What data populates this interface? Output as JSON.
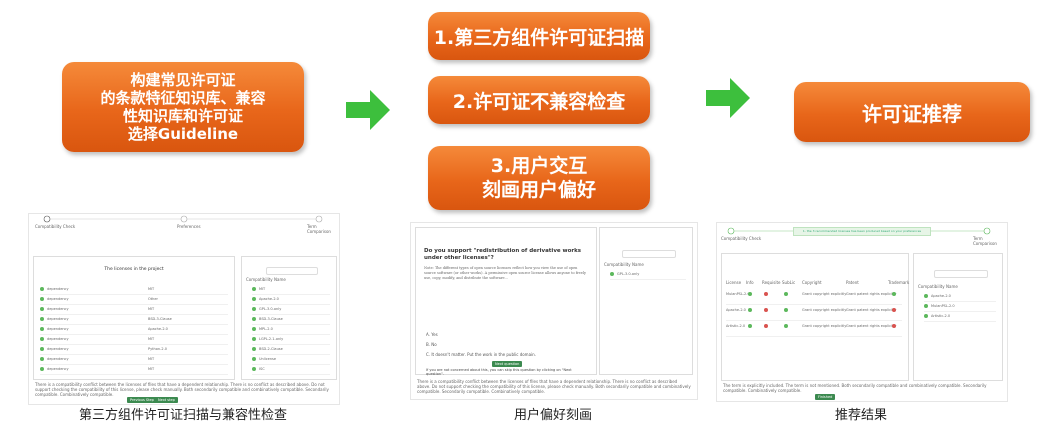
{
  "steps": {
    "build_kb": "构建常见许可证\n的条款特征知识库、兼容\n性知识库和许可证\n选择Guideline",
    "scan": "1.第三方组件许可证扫描",
    "incompat": "2.许可证不兼容检查",
    "interact": "3.用户交互\n刻画用户偏好",
    "recommend": "许可证推荐"
  },
  "captions": {
    "left": "第三方组件许可证扫描与兼容性检查",
    "middle": "用户偏好刻画",
    "right": "推荐结果"
  },
  "colors": {
    "box": "#e8661a",
    "arrow": "#3dbf3d"
  },
  "screens": {
    "left": {
      "steps": [
        "Compatibility Check",
        "Preferences",
        "Term Comparison"
      ],
      "table_title": "The licenses in the project",
      "licenses": [
        "MIT",
        "Other",
        "MIT",
        "BSD-3-Clause",
        "Apache-2.0",
        "MIT",
        "Python-2.0",
        "MIT",
        "MIT"
      ],
      "right_list": [
        "MIT",
        "Apache-2.0",
        "GPL-3.0-only",
        "BSD-3-Clause",
        "MPL-2.0",
        "LGPL-2.1-only",
        "BSD-2-Clause",
        "Unlicense",
        "ISC"
      ],
      "right_headers": [
        "Compatibility",
        "Name"
      ],
      "buttons": [
        "Previous Step",
        "Next step"
      ],
      "legend": "There is a compatibility conflict between the licenses of files that have a dependent relationship. There is no conflict as described above. Do not support checking the compatibility of this license, please check manually. Both secondarily compatible and combinatively compatible. Secondarily compatible. Combinatively compatible."
    },
    "middle": {
      "question": "Do you support \"redistribution of derivative works under other licenses\"?",
      "note": "Note: The different types of open source licenses reflect how you view the use of open source software (or other works). A permissive open source license allows anyone to freely use, copy, modify, and distribute the software...",
      "options": [
        "A. Yes",
        "B. No",
        "C. It doesn't matter. Put the work in the public domain."
      ],
      "next": "Next question",
      "skip": "If you are not concerned about this, you can skip this question by clicking on \"Next question\".",
      "side_headers": [
        "Compatibility",
        "Name"
      ],
      "side_item": "GPL-3.0-only",
      "legend": "There is a compatibility conflict between the licenses of files that have a dependent relationship. There is no conflict as described above. Do not support checking the compatibility of this license, please check manually. Both secondarily compatible and combinatively compatible. Secondarily compatible. Combinatively compatible."
    },
    "right": {
      "banner": "1. the 3 recommended licenses has been produced based on your preferences",
      "steps": [
        "Compatibility Check",
        "Term Comparison"
      ],
      "col_headers": [
        "License",
        "Info",
        "Requisite",
        "SubLic",
        "Copyright",
        "Patent",
        "Trademark"
      ],
      "rows": [
        "MulanPSL-2.0",
        "Apache-2.0",
        "Artistic-2.0"
      ],
      "copyright_text": "Grant copyright explicitly",
      "patent_text": "Grant patent rights explicitly",
      "side_headers": [
        "Compatibility",
        "Name"
      ],
      "side_items": [
        "Apache-2.0",
        "MulanPSL-2.0",
        "Artistic-2.0"
      ],
      "legend": "The term is explicitly included. The term is not mentioned. Both secondarily compatible and combinatively compatible. Secondarily compatible. Combinatively compatible.",
      "button": "Finished"
    }
  }
}
